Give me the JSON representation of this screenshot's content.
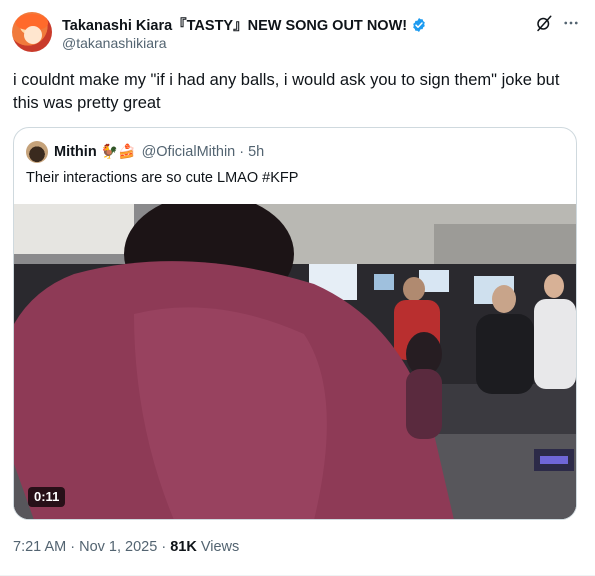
{
  "author": {
    "display_name": "Takanashi Kiara『TASTY』NEW SONG OUT NOW!",
    "handle": "@takanashikiara",
    "verified_color": "#1d9bf0"
  },
  "tweet": {
    "text": "i couldnt make my \"if i had any balls, i would ask you to sign them\" joke but this was pretty great"
  },
  "quote": {
    "name": "Mithin",
    "emojis": "🐓🍰",
    "handle": "@OficialMithin",
    "separator": "·",
    "time": "5h",
    "text": "Their interactions are so cute LMAO #KFP",
    "video_duration": "0:11"
  },
  "meta": {
    "time": "7:21 AM",
    "separator": "·",
    "date": "Nov 1, 2025",
    "views_count": "81K",
    "views_label": "Views"
  },
  "icons": {
    "grok": "grok-icon",
    "more": "more-dots-icon",
    "verified": "verified-badge-icon"
  },
  "colors": {
    "text": "#0f1419",
    "secondary": "#536471",
    "border": "#cfd9de",
    "accent": "#1d9bf0"
  }
}
